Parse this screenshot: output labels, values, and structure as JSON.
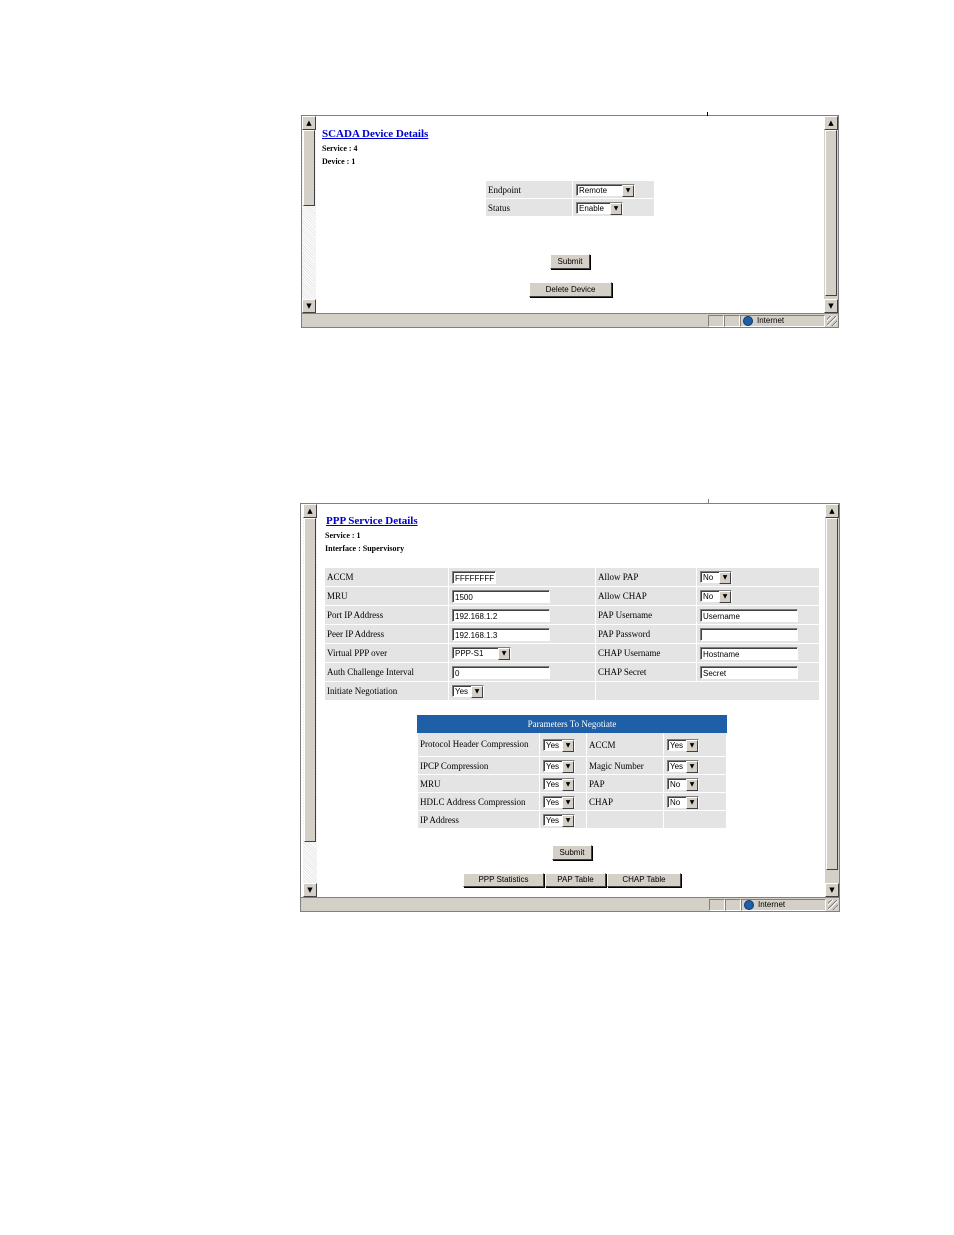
{
  "top_window": {
    "title": "SCADA Device Details",
    "service_line": "Service : 4",
    "device_line": "Device : 1",
    "fields": [
      {
        "label": "Endpoint",
        "value": "Remote"
      },
      {
        "label": "Status",
        "value": "Enable"
      }
    ],
    "submit_label": "Submit",
    "delete_label": "Delete Device",
    "status_zone": "Internet"
  },
  "bottom_window": {
    "title": "PPP Service Details",
    "service_line": "Service : 1",
    "interface_line": "Interface : Supervisory",
    "left_rows": [
      {
        "label": "ACCM",
        "value": "FFFFFFFF"
      },
      {
        "label": "MRU",
        "value": "1500"
      },
      {
        "label": "Port IP Address",
        "value": "192.168.1.2"
      },
      {
        "label": "Peer IP Address",
        "value": "192.168.1.3"
      },
      {
        "label": "Virtual PPP over",
        "value": "PPP-S1"
      },
      {
        "label": "Auth Challenge Interval",
        "value": "0"
      },
      {
        "label": "Initiate Negotiation",
        "value": "Yes"
      }
    ],
    "right_rows": [
      {
        "label": "Allow PAP",
        "value": "No"
      },
      {
        "label": "Allow CHAP",
        "value": "No"
      },
      {
        "label": "PAP Username",
        "value": "Username"
      },
      {
        "label": "PAP Password",
        "value": ""
      },
      {
        "label": "CHAP Username",
        "value": "Hostname"
      },
      {
        "label": "CHAP Secret",
        "value": "Secret"
      }
    ],
    "negotiate": {
      "header": "Parameters To Negotiate",
      "header_color": "#1f5fa8",
      "rows": [
        {
          "l_label": "Protocol Header Compression",
          "l_value": "Yes",
          "r_label": "ACCM",
          "r_value": "Yes"
        },
        {
          "l_label": "IPCP Compression",
          "l_value": "Yes",
          "r_label": "Magic Number",
          "r_value": "Yes"
        },
        {
          "l_label": "MRU",
          "l_value": "Yes",
          "r_label": "PAP",
          "r_value": "No"
        },
        {
          "l_label": "HDLC Address Compression",
          "l_value": "Yes",
          "r_label": "CHAP",
          "r_value": "No"
        },
        {
          "l_label": "IP Address",
          "l_value": "Yes",
          "r_label": "",
          "r_value": ""
        }
      ]
    },
    "submit_label": "Submit",
    "tabs": [
      "PPP Statistics",
      "PAP Table",
      "CHAP Table"
    ],
    "status_zone": "Internet"
  },
  "icons": {
    "scroll_up": "▲",
    "scroll_down": "▼",
    "dropdown": "▼"
  }
}
